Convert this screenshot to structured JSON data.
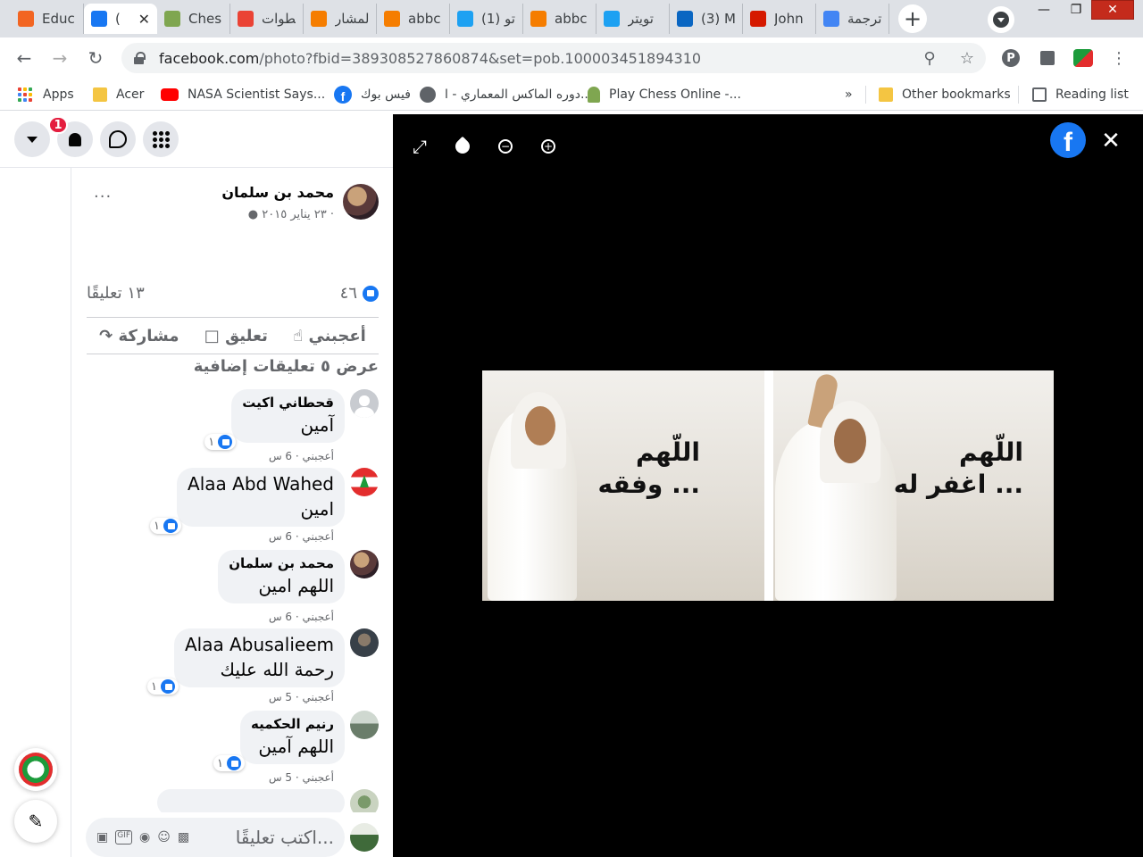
{
  "browser": {
    "tabs": [
      {
        "title": "Educ",
        "icon": "nrc-favicon",
        "color": "#f26522"
      },
      {
        "title": "(",
        "icon": "facebook-favicon",
        "color": "#1877f2",
        "active": true
      },
      {
        "title": "Ches",
        "icon": "chess-pawn-favicon",
        "color": "#7fa650"
      },
      {
        "title": "خطوات",
        "icon": "gmail-favicon",
        "color": "#ea4335"
      },
      {
        "title": "المشار",
        "icon": "blogger-favicon",
        "color": "#f57d00"
      },
      {
        "title": "abbc",
        "icon": "blogger-favicon",
        "color": "#f57d00"
      },
      {
        "title": "(1) تو",
        "icon": "twitter-favicon",
        "color": "#1da1f2"
      },
      {
        "title": "abbc",
        "icon": "blogger-favicon",
        "color": "#f57d00"
      },
      {
        "title": "تويتر",
        "icon": "twitter-favicon",
        "color": "#1da1f2"
      },
      {
        "title": "(3) M",
        "icon": "linkedin-favicon",
        "color": "#0a66c2"
      },
      {
        "title": "John",
        "icon": "jnj-favicon",
        "color": "#d51900"
      },
      {
        "title": "ترجمة",
        "icon": "google-translate-favicon",
        "color": "#4285f4"
      }
    ],
    "url_host": "facebook.com",
    "url_path": "/photo?fbid=389308527860874&set=pob.100003451894310",
    "bookmarks": [
      {
        "label": "Apps",
        "icon": "apps-grid-icon"
      },
      {
        "label": "Acer",
        "icon": "folder-icon"
      },
      {
        "label": "NASA Scientist Says...",
        "icon": "youtube-icon"
      },
      {
        "label": "فيس بوك",
        "icon": "facebook-icon"
      },
      {
        "label": "دوره الماكس المعماري - ا...",
        "icon": "globe-icon"
      },
      {
        "label": "Play Chess Online -...",
        "icon": "chess-pawn-icon"
      }
    ],
    "bookmarks_overflow": "»",
    "other_bookmarks": "Other bookmarks",
    "reading_list": "Reading list"
  },
  "fb_header": {
    "notification_count": "1"
  },
  "post": {
    "author": "محمد بن سلمان",
    "date": "٢٣ يناير ٢٠١٥ ·",
    "like_count": "٤٦",
    "comment_count": "١٣ تعليقًا",
    "actions": {
      "like": "أعجبني",
      "comment": "تعليق",
      "share": "مشاركة"
    },
    "more_comments": "عرض ٥ تعليقات إضافية"
  },
  "comments": [
    {
      "name": "قحطاني اكيت",
      "text": "آمين",
      "reactions": "١",
      "like_label": "أعجبني",
      "time": "6 س"
    },
    {
      "name": "Alaa Abd Wahed",
      "text": "امين",
      "reactions": "١",
      "like_label": "أعجبني",
      "time": "6 س"
    },
    {
      "name": "محمد بن سلمان",
      "text": "اللهم امين",
      "reactions": "",
      "like_label": "أعجبني",
      "time": "6 س"
    },
    {
      "name": "Alaa Abusalieem",
      "text": "رحمة الله عليك",
      "reactions": "١",
      "like_label": "أعجبني",
      "time": "5 س"
    },
    {
      "name": "رنيم الحكميه",
      "text": "اللهم آمين",
      "reactions": "١",
      "like_label": "أعجبني",
      "time": "5 س"
    }
  ],
  "composer": {
    "placeholder": "اكتب تعليقًا..."
  },
  "photo": {
    "left_caption_line1": "اللّهم",
    "left_caption_line2": "وفقه ...",
    "right_caption_line1": "اللّهم",
    "right_caption_line2": "اغفر له ..."
  }
}
